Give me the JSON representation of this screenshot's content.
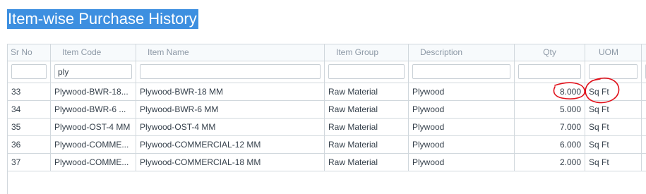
{
  "page": {
    "title": "Item-wise Purchase History"
  },
  "columns": [
    "Sr No",
    "Item Code",
    "Item Name",
    "Item Group",
    "Description",
    "Qty",
    "UOM"
  ],
  "filters": {
    "item_code": "ply"
  },
  "rows": [
    {
      "sr": "33",
      "code": "Plywood-BWR-18...",
      "name": "Plywood-BWR-18 MM",
      "group": "Raw Material",
      "desc": "Plywood",
      "qty": "8.000",
      "uom": "Sq Ft"
    },
    {
      "sr": "34",
      "code": "Plywood-BWR-6 ...",
      "name": "Plywood-BWR-6 MM",
      "group": "Raw Material",
      "desc": "Plywood",
      "qty": "5.000",
      "uom": "Sq Ft"
    },
    {
      "sr": "35",
      "code": "Plywood-OST-4 MM",
      "name": "Plywood-OST-4 MM",
      "group": "Raw Material",
      "desc": "Plywood",
      "qty": "7.000",
      "uom": "Sq Ft"
    },
    {
      "sr": "36",
      "code": "Plywood-COMME...",
      "name": "Plywood-COMMERCIAL-12 MM",
      "group": "Raw Material",
      "desc": "Plywood",
      "qty": "6.000",
      "uom": "Sq Ft"
    },
    {
      "sr": "37",
      "code": "Plywood-COMME...",
      "name": "Plywood-COMMERCIAL-18 MM",
      "group": "Raw Material",
      "desc": "Plywood",
      "qty": "2.000",
      "uom": "Sq Ft"
    }
  ],
  "colors": {
    "title_highlight": "#3d8fe0",
    "grid_border": "#d1d8dd",
    "annotation": "#e0101a"
  }
}
